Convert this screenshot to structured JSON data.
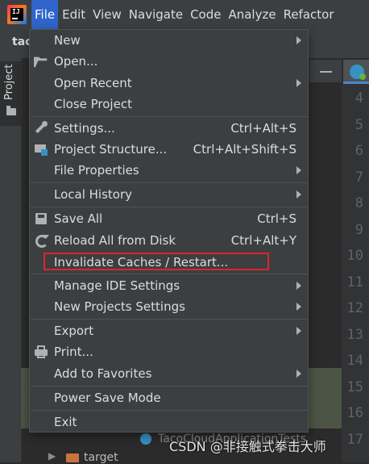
{
  "menubar": {
    "items": [
      "File",
      "Edit",
      "View",
      "Navigate",
      "Code",
      "Analyze",
      "Refactor"
    ]
  },
  "sidebar": {
    "project_tab_label": "Project"
  },
  "workspace": {
    "project_name": "tac",
    "line_numbers": [
      "4",
      "5",
      "6",
      "7",
      "8",
      "9",
      "10",
      "11",
      "12",
      "13",
      "14",
      "15",
      "16",
      "17"
    ],
    "tree_item_test": "TacoCloudApplicationTests",
    "tree_item_target": "target"
  },
  "file_menu": {
    "new": "New",
    "open": "Open...",
    "open_recent": "Open Recent",
    "close_project": "Close Project",
    "settings": "Settings...",
    "settings_shortcut": "Ctrl+Alt+S",
    "project_structure": "Project Structure...",
    "project_structure_shortcut": "Ctrl+Alt+Shift+S",
    "file_properties": "File Properties",
    "local_history": "Local History",
    "save_all": "Save All",
    "save_all_shortcut": "Ctrl+S",
    "reload_all": "Reload All from Disk",
    "reload_all_shortcut": "Ctrl+Alt+Y",
    "invalidate_caches": "Invalidate Caches / Restart...",
    "manage_ide_settings": "Manage IDE Settings",
    "new_projects_settings": "New Projects Settings",
    "export": "Export",
    "print": "Print...",
    "add_to_favorites": "Add to Favorites",
    "power_save_mode": "Power Save Mode",
    "exit": "Exit"
  },
  "watermark": "CSDN @非接触式拳击大师",
  "colors": {
    "menu_bg": "#3c3f41",
    "editor_bg": "#2b2b2b",
    "active_menu": "#2f65ca",
    "highlight": "#e0242b"
  }
}
